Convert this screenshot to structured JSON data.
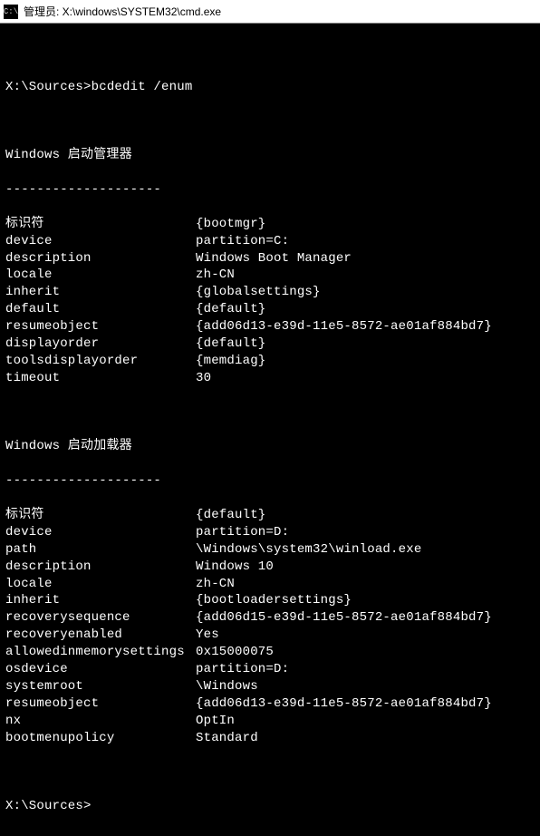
{
  "titlebar": {
    "icon_label": "C:\\",
    "text": "管理员: X:\\windows\\SYSTEM32\\cmd.exe"
  },
  "prompt1": {
    "path": "X:\\Sources>",
    "command": "bcdedit /enum"
  },
  "section1": {
    "title": "Windows 启动管理器",
    "divider": "--------------------",
    "rows": [
      {
        "k": "标识符",
        "v": "{bootmgr}"
      },
      {
        "k": "device",
        "v": "partition=C:"
      },
      {
        "k": "description",
        "v": "Windows Boot Manager"
      },
      {
        "k": "locale",
        "v": "zh-CN"
      },
      {
        "k": "inherit",
        "v": "{globalsettings}"
      },
      {
        "k": "default",
        "v": "{default}"
      },
      {
        "k": "resumeobject",
        "v": "{add06d13-e39d-11e5-8572-ae01af884bd7}"
      },
      {
        "k": "displayorder",
        "v": "{default}"
      },
      {
        "k": "toolsdisplayorder",
        "v": "{memdiag}"
      },
      {
        "k": "timeout",
        "v": "30"
      }
    ]
  },
  "section2": {
    "title": "Windows 启动加载器",
    "divider": "--------------------",
    "rows": [
      {
        "k": "标识符",
        "v": "{default}"
      },
      {
        "k": "device",
        "v": "partition=D:"
      },
      {
        "k": "path",
        "v": "\\Windows\\system32\\winload.exe"
      },
      {
        "k": "description",
        "v": "Windows 10"
      },
      {
        "k": "locale",
        "v": "zh-CN"
      },
      {
        "k": "inherit",
        "v": "{bootloadersettings}"
      },
      {
        "k": "recoverysequence",
        "v": "{add06d15-e39d-11e5-8572-ae01af884bd7}"
      },
      {
        "k": "recoveryenabled",
        "v": "Yes"
      },
      {
        "k": "allowedinmemorysettings",
        "v": "0x15000075"
      },
      {
        "k": "osdevice",
        "v": "partition=D:"
      },
      {
        "k": "systemroot",
        "v": "\\Windows"
      },
      {
        "k": "resumeobject",
        "v": "{add06d13-e39d-11e5-8572-ae01af884bd7}"
      },
      {
        "k": "nx",
        "v": "OptIn"
      },
      {
        "k": "bootmenupolicy",
        "v": "Standard"
      }
    ]
  },
  "prompt2": {
    "path": "X:\\Sources>"
  }
}
